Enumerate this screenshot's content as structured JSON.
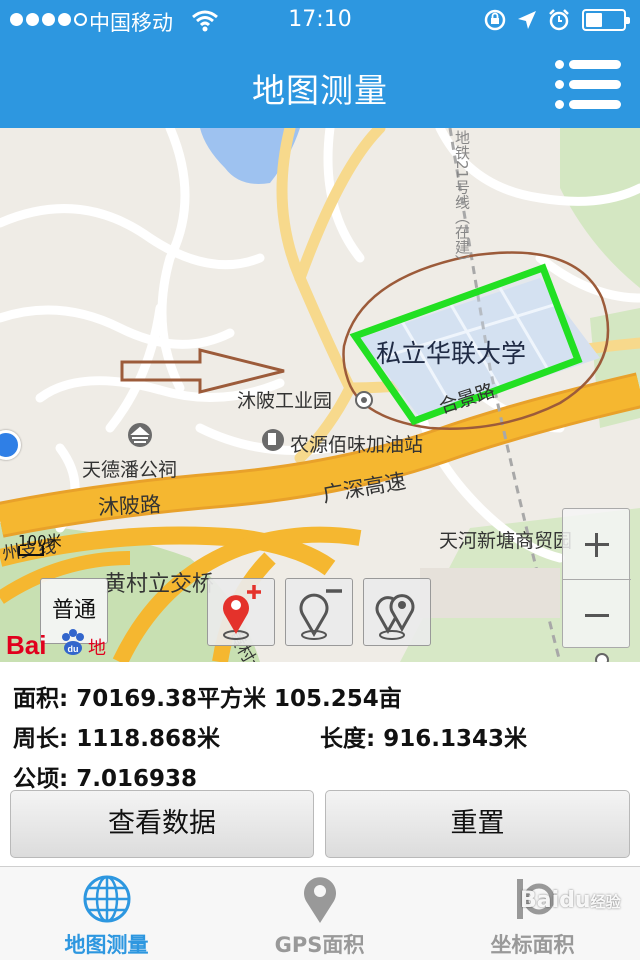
{
  "status_bar": {
    "carrier": "中国移动",
    "time": "17:10",
    "battery_level": 0.45
  },
  "nav": {
    "title": "地图测量"
  },
  "map": {
    "poi": {
      "muling_industrial_park": "沐陂工业园",
      "gas_station": "农源佰味加油站",
      "tiande_company": "天德潘公祠",
      "tianhe_market": "天河新塘商贸园"
    },
    "roads": {
      "muling_road": "沐陂路",
      "guangshen_expressway": "广深高速",
      "hemei_road": "合景路",
      "huangcun_interchange": "黄村立交桥",
      "guangzhou_branch": "州支线",
      "huangcun_other": "黄村大",
      "metro_line": "地铁21号线（在建）"
    },
    "highlight_label": "私立华联大学",
    "scale_label": "100米",
    "maptype_label": "普通",
    "baidu_logo_text": "Bai",
    "baidu_map_text": "地图"
  },
  "results": {
    "area_label": "面积:",
    "area_value": "70169.38平方米 105.254亩",
    "perimeter_label": "周长:",
    "perimeter_value": "1118.868米",
    "length_label": "长度:",
    "length_value": "916.1343米",
    "hectare_label": "公顷:",
    "hectare_value": "7.016938"
  },
  "actions": {
    "view_data": "查看数据",
    "reset": "重置"
  },
  "tabs": [
    {
      "label": "地图测量",
      "icon": "globe-icon",
      "active": true
    },
    {
      "label": "GPS面积",
      "icon": "location-pin-icon",
      "active": false
    },
    {
      "label": "坐标面积",
      "icon": "coordinate-icon",
      "active": false
    }
  ],
  "watermark": {
    "brand": "Baidu",
    "sub": "经验"
  },
  "colors": {
    "primary": "#2d97e0",
    "highlight": "#22e022",
    "expressway": "#f5b730",
    "annotation": "#9c5b3a",
    "baidu_red": "#e1001d"
  }
}
